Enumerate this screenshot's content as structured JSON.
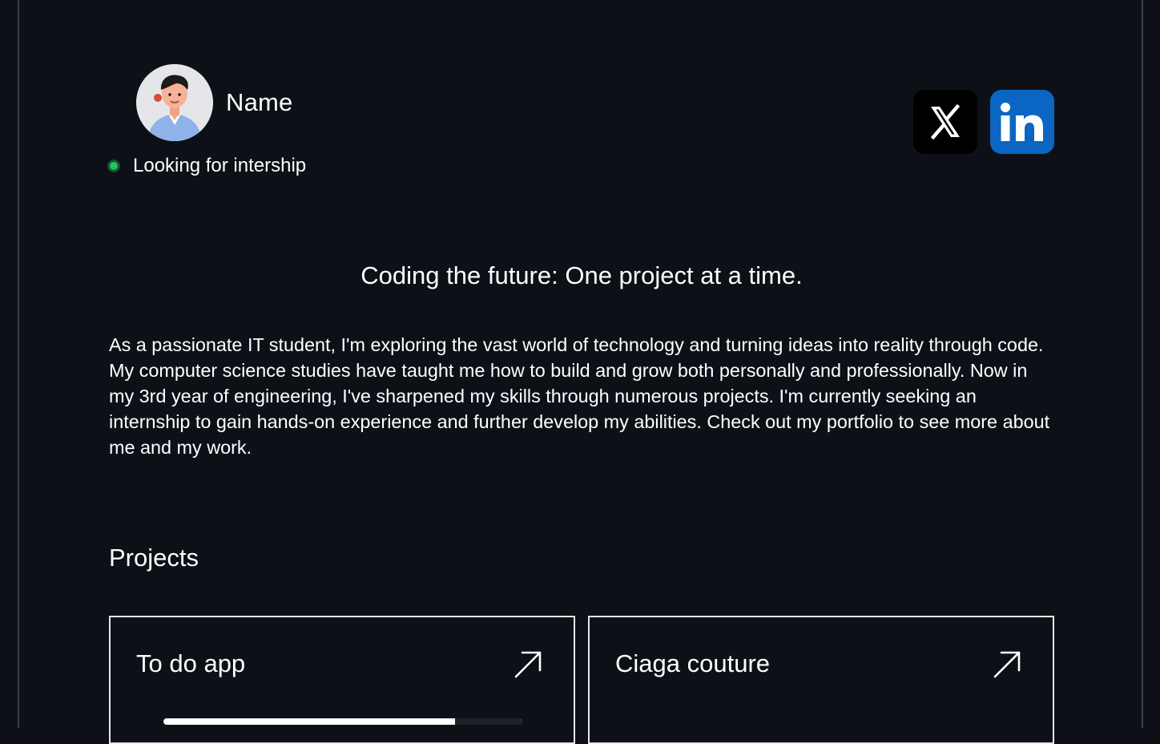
{
  "profile": {
    "name": "Name",
    "status": "Looking for intership",
    "status_color": "#22c55e"
  },
  "socials": [
    {
      "label": "X",
      "icon": "x-logo-icon",
      "color": "#000000"
    },
    {
      "label": "LinkedIn",
      "icon": "linkedin-logo-icon",
      "color": "#0a66c2"
    }
  ],
  "tagline": "Coding the future: One project at a time.",
  "bio": "As a passionate IT student, I'm exploring the vast world of technology and turning ideas into reality through code. My computer science studies have taught me how to build and grow both personally and professionally. Now in my 3rd year of engineering, I've sharpened my skills through numerous projects. I'm currently seeking an internship to gain hands-on experience and further develop my abilities. Check out my portfolio to see more about me and my work.",
  "projects": {
    "title": "Projects",
    "items": [
      {
        "title": "To do app",
        "icon": "arrow-up-right-icon"
      },
      {
        "title": "Ciaga couture",
        "icon": "arrow-up-right-icon"
      }
    ]
  },
  "colors": {
    "background": "#0d1117",
    "text": "#ffffff",
    "card_border": "#e6e6e6"
  }
}
